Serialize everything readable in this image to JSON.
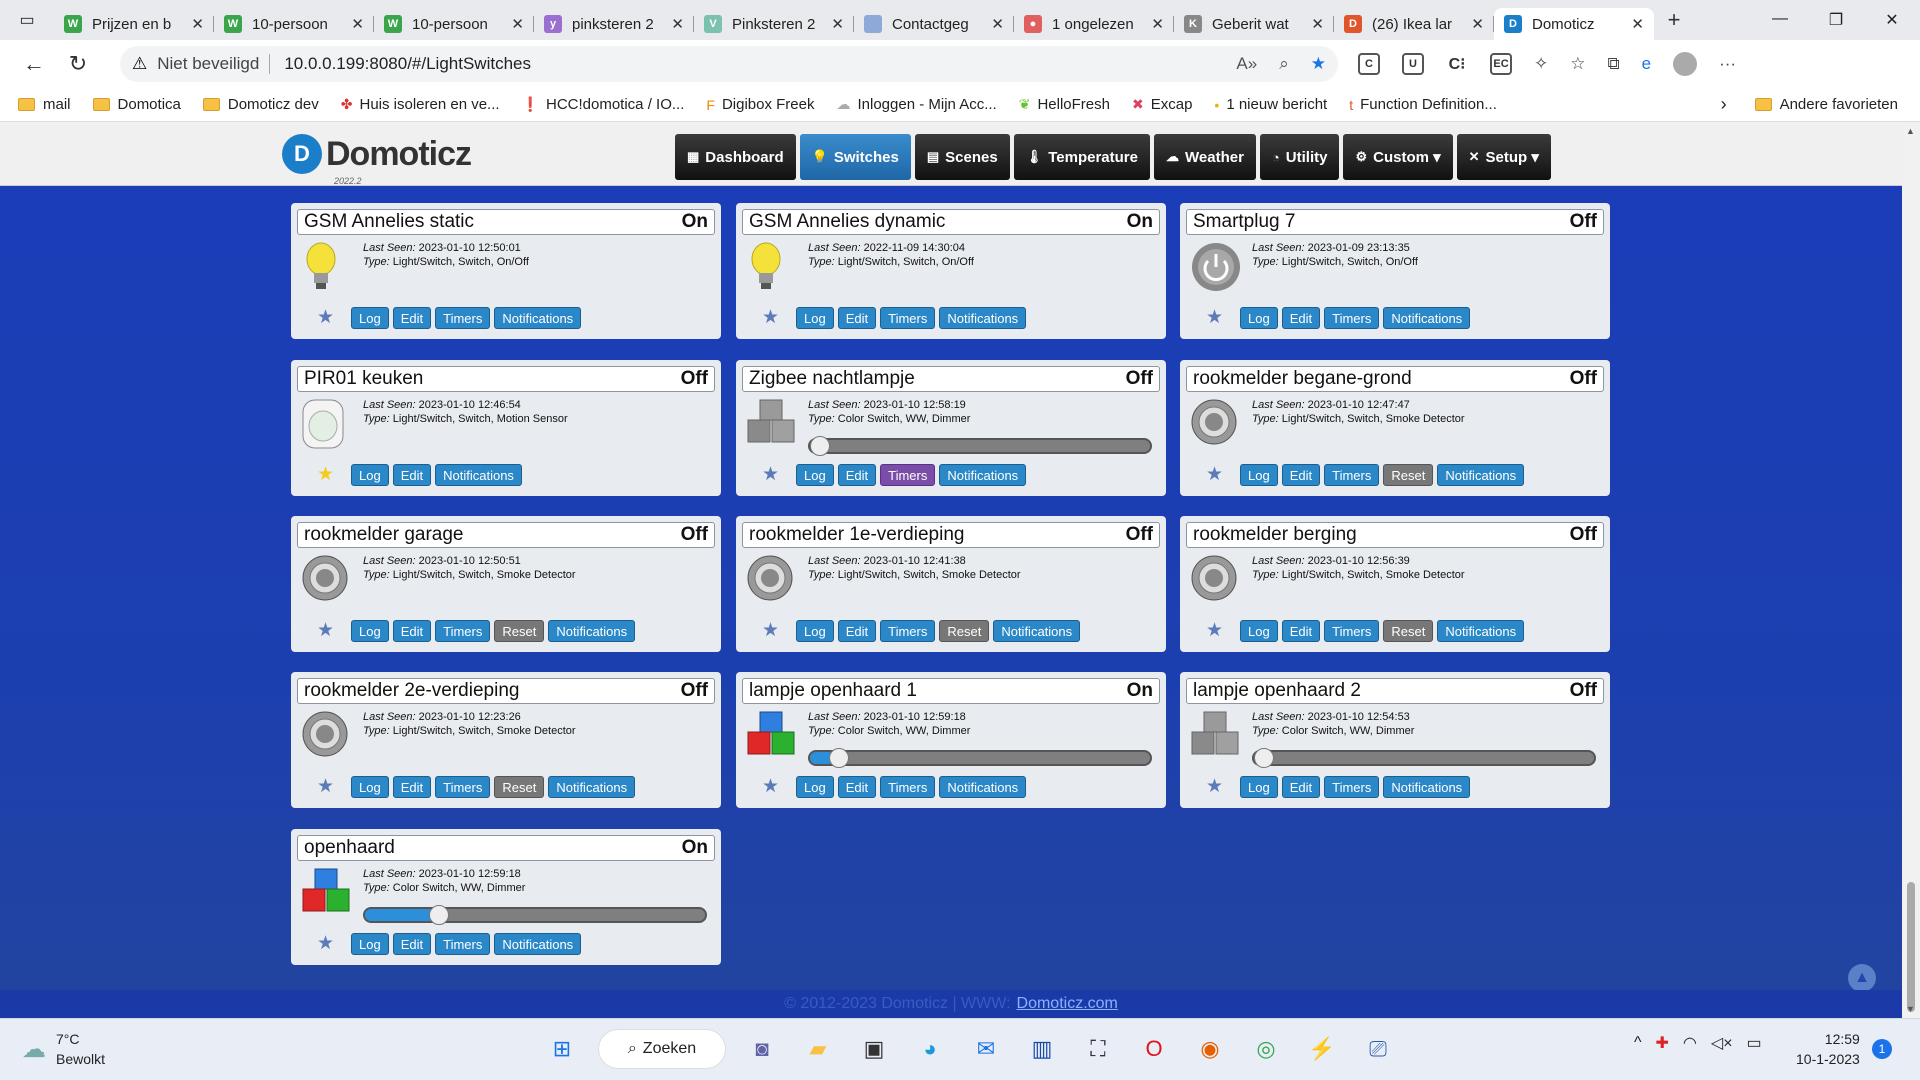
{
  "browser": {
    "tabs": [
      {
        "title": "Prijzen en b",
        "fav_color": "#3aa54a",
        "fav_glyph": "W"
      },
      {
        "title": "10-persoon",
        "fav_color": "#3aa54a",
        "fav_glyph": "W"
      },
      {
        "title": "10-persoon",
        "fav_color": "#3aa54a",
        "fav_glyph": "W"
      },
      {
        "title": "pinksteren 2",
        "fav_color": "#9a6fd0",
        "fav_glyph": "y"
      },
      {
        "title": "Pinksteren 2",
        "fav_color": "#7cc0b0",
        "fav_glyph": "V"
      },
      {
        "title": "Contactgeg",
        "fav_color": "#8ea8d8",
        "fav_glyph": ""
      },
      {
        "title": "1 ongelezen",
        "fav_color": "#e06060",
        "fav_glyph": "●"
      },
      {
        "title": "Geberit wat",
        "fav_color": "#888888",
        "fav_glyph": "K"
      },
      {
        "title": "(26) Ikea lar",
        "fav_color": "#e0552a",
        "fav_glyph": "D"
      },
      {
        "title": "Domoticz",
        "fav_color": "#1a7fc8",
        "fav_glyph": "D",
        "active": true
      }
    ],
    "url_security": "Niet beveiligd",
    "url": "10.0.0.199:8080/#/LightSwitches",
    "bookmarks": [
      {
        "label": "mail",
        "icon": "folder"
      },
      {
        "label": "Domotica",
        "icon": "folder"
      },
      {
        "label": "Domoticz dev",
        "icon": "folder"
      },
      {
        "label": "Huis isoleren en ve...",
        "icon": "pinwheel-icon"
      },
      {
        "label": "HCC!domotica / IO...",
        "icon": "alert-icon"
      },
      {
        "label": "Digibox Freek",
        "icon": "f-icon"
      },
      {
        "label": "Inloggen - Mijn Acc...",
        "icon": "cloud-icon"
      },
      {
        "label": "HelloFresh",
        "icon": "leaf-icon"
      },
      {
        "label": "Excap",
        "icon": "x-icon"
      },
      {
        "label": "1 nieuw bericht",
        "icon": "dot-icon"
      },
      {
        "label": "Function Definition...",
        "icon": "t-icon"
      }
    ],
    "bookmarks_other": "Andere favorieten"
  },
  "app": {
    "logo_name": "Domoticz",
    "version": "2022.2",
    "menu": [
      {
        "label": "Dashboard",
        "icon": "▦"
      },
      {
        "label": "Switches",
        "icon": "💡",
        "active": true
      },
      {
        "label": "Scenes",
        "icon": "▤"
      },
      {
        "label": "Temperature",
        "icon": "🌡"
      },
      {
        "label": "Weather",
        "icon": "☁"
      },
      {
        "label": "Utility",
        "icon": "◔"
      },
      {
        "label": "Custom ▾",
        "icon": "⚙"
      },
      {
        "label": "Setup ▾",
        "icon": "✕"
      }
    ],
    "last_seen_label": "Last Seen:",
    "type_label": "Type:"
  },
  "devices": [
    {
      "name": "GSM Annelies static",
      "status": "On",
      "last_seen": "2023-01-10 12:50:01",
      "type": "Light/Switch, Switch, On/Off",
      "icon": "bulb-on-icon",
      "favorite": false,
      "buttons": [
        "Log",
        "Edit",
        "Timers",
        "Notifications"
      ]
    },
    {
      "name": "GSM Annelies dynamic",
      "status": "On",
      "last_seen": "2022-11-09 14:30:04",
      "type": "Light/Switch, Switch, On/Off",
      "icon": "bulb-on-icon",
      "favorite": false,
      "buttons": [
        "Log",
        "Edit",
        "Timers",
        "Notifications"
      ]
    },
    {
      "name": "Smartplug 7",
      "status": "Off",
      "last_seen": "2023-01-09 23:13:35",
      "type": "Light/Switch, Switch, On/Off",
      "icon": "power-off-icon",
      "favorite": false,
      "buttons": [
        "Log",
        "Edit",
        "Timers",
        "Notifications"
      ]
    },
    {
      "name": "PIR01 keuken",
      "status": "Off",
      "last_seen": "2023-01-10 12:46:54",
      "type": "Light/Switch, Switch, Motion Sensor",
      "icon": "motion-sensor-icon",
      "favorite": true,
      "buttons": [
        "Log",
        "Edit",
        "Notifications"
      ]
    },
    {
      "name": "Zigbee nachtlampje",
      "status": "Off",
      "last_seen": "2023-01-10 12:58:19",
      "type": "Color Switch, WW, Dimmer",
      "icon": "rgb-cubes-off-icon",
      "favorite": false,
      "slider": 0.0,
      "buttons": [
        "Log",
        "Edit",
        "Timers",
        "Notifications"
      ],
      "timers_active": true
    },
    {
      "name": "rookmelder begane-grond",
      "status": "Off",
      "last_seen": "2023-01-10 12:47:47",
      "type": "Light/Switch, Switch, Smoke Detector",
      "icon": "smoke-detector-icon",
      "favorite": false,
      "buttons": [
        "Log",
        "Edit",
        "Timers",
        "Reset",
        "Notifications"
      ]
    },
    {
      "name": "rookmelder garage",
      "status": "Off",
      "last_seen": "2023-01-10 12:50:51",
      "type": "Light/Switch, Switch, Smoke Detector",
      "icon": "smoke-detector-icon",
      "favorite": false,
      "buttons": [
        "Log",
        "Edit",
        "Timers",
        "Reset",
        "Notifications"
      ]
    },
    {
      "name": "rookmelder 1e-verdieping",
      "status": "Off",
      "last_seen": "2023-01-10 12:41:38",
      "type": "Light/Switch, Switch, Smoke Detector",
      "icon": "smoke-detector-icon",
      "favorite": false,
      "buttons": [
        "Log",
        "Edit",
        "Timers",
        "Reset",
        "Notifications"
      ]
    },
    {
      "name": "rookmelder berging",
      "status": "Off",
      "last_seen": "2023-01-10 12:56:39",
      "type": "Light/Switch, Switch, Smoke Detector",
      "icon": "smoke-detector-icon",
      "favorite": false,
      "buttons": [
        "Log",
        "Edit",
        "Timers",
        "Reset",
        "Notifications"
      ]
    },
    {
      "name": "rookmelder 2e-verdieping",
      "status": "Off",
      "last_seen": "2023-01-10 12:23:26",
      "type": "Light/Switch, Switch, Smoke Detector",
      "icon": "smoke-detector-icon",
      "favorite": false,
      "buttons": [
        "Log",
        "Edit",
        "Timers",
        "Reset",
        "Notifications"
      ]
    },
    {
      "name": "lampje openhaard 1",
      "status": "On",
      "last_seen": "2023-01-10 12:59:18",
      "type": "Color Switch, WW, Dimmer",
      "icon": "rgb-cubes-on-icon",
      "favorite": false,
      "slider": 0.06,
      "buttons": [
        "Log",
        "Edit",
        "Timers",
        "Notifications"
      ]
    },
    {
      "name": "lampje openhaard 2",
      "status": "Off",
      "last_seen": "2023-01-10 12:54:53",
      "type": "Color Switch, WW, Dimmer",
      "icon": "rgb-cubes-off-icon",
      "favorite": false,
      "slider": 0.0,
      "buttons": [
        "Log",
        "Edit",
        "Timers",
        "Notifications"
      ]
    },
    {
      "name": "openhaard",
      "status": "On",
      "last_seen": "2023-01-10 12:59:18",
      "type": "Color Switch, WW, Dimmer",
      "icon": "rgb-cubes-on-icon",
      "favorite": false,
      "slider": 0.2,
      "buttons": [
        "Log",
        "Edit",
        "Timers",
        "Notifications"
      ]
    }
  ],
  "footer": {
    "copyright": "© 2012-2023 Domoticz | WWW:",
    "link": "Domoticz.com"
  },
  "taskbar": {
    "temperature": "7°C",
    "condition": "Bewolkt",
    "search_label": "Zoeken",
    "time": "12:59",
    "date": "10-1-2023",
    "notifications": "1"
  }
}
